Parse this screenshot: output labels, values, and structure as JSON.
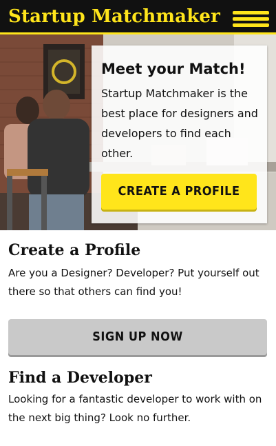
{
  "header": {
    "brand": "Startup Matchmaker",
    "menu_icon": "hamburger-menu-icon"
  },
  "hero": {
    "title": "Meet your Match!",
    "text": "Startup Matchmaker is the best place for designers and developers to find each other.",
    "cta_label": "CREATE A PROFILE"
  },
  "sections": [
    {
      "title": "Create a Profile",
      "text": "Are you a Designer? Developer? Put yourself out there so that others can find you!",
      "button_label": "SIGN UP NOW"
    },
    {
      "title": "Find a Developer",
      "text": "Looking for a fantastic developer to work with on the next big thing? Look no further."
    }
  ],
  "colors": {
    "brand_yellow": "#ffe51b",
    "header_bg": "#111111",
    "button_gray": "#c9c9c9"
  }
}
